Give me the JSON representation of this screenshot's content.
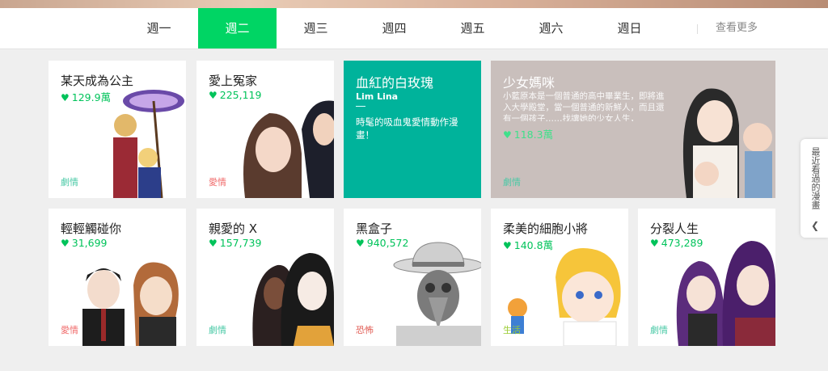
{
  "tabs": [
    "週一",
    "週二",
    "週三",
    "週四",
    "週五",
    "週六",
    "週日"
  ],
  "active_tab": "週二",
  "more_label": "查看更多",
  "side_tab_label": "最近看過的漫畫",
  "icons": {
    "heart": "heart-icon",
    "chevron": "chevron-left-icon"
  },
  "colors": {
    "accent": "#00d564",
    "likes": "#00c35a",
    "genre_drama": "#49c9a6",
    "genre_romance": "#f06b6b",
    "genre_horror": "#e05a52",
    "genre_life": "#9acd32",
    "teal_card": "#00b39b"
  },
  "cards": [
    {
      "title": "某天成為公主",
      "likes": "129.9萬",
      "genre": "劇情"
    },
    {
      "title": "愛上冤家",
      "likes": "225,119",
      "genre": "愛情"
    },
    {
      "title": "血紅的白玫瑰",
      "author": "Lim Lina",
      "desc": "時髦的吸血鬼愛情動作漫畫！"
    },
    {
      "title": "少女媽咪",
      "desc": "小藍原本是一個普通的高中畢業生，即將進入大學殿堂，當一個普通的新鮮人，而且還有一個孩子……找讓她的少女人生，",
      "likes": "118.3萬",
      "genre": "劇情"
    },
    {
      "title": "輕輕觸碰你",
      "likes": "31,699",
      "genre": "愛情"
    },
    {
      "title": "親愛的 X",
      "likes": "157,739",
      "genre": "劇情"
    },
    {
      "title": "黑盒子",
      "likes": "940,572",
      "genre": "恐怖"
    },
    {
      "title": "柔美的細胞小將",
      "likes": "140.8萬",
      "genre": "生活"
    },
    {
      "title": "分裂人生",
      "likes": "473,289",
      "genre": "劇情"
    }
  ]
}
